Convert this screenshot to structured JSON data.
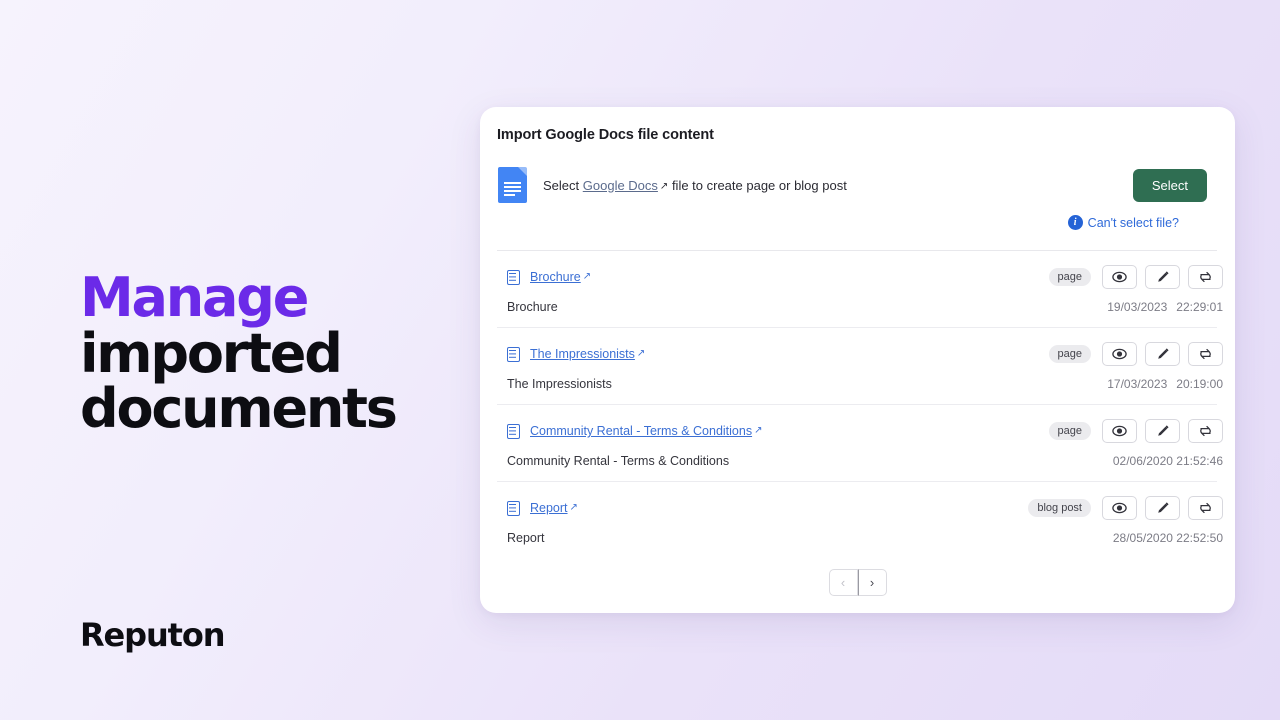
{
  "promo": {
    "headline_accent": "Manage",
    "headline_line2": "imported",
    "headline_line3": "documents",
    "accent_color": "#6b2ae8",
    "brand_name": "Reputon"
  },
  "card": {
    "title": "Import Google Docs file content",
    "picker": {
      "file_icon": "google-docs-file-icon",
      "text_before": "Select",
      "link_label": "Google Docs",
      "external_glyph": "↗",
      "text_after": "file to create page or blog post",
      "select_button": "Select",
      "select_button_color": "#2f6e52"
    },
    "help": {
      "info_icon": "info-circle-icon",
      "link_label": "Can't select file?",
      "link_color": "#2f6ad9"
    },
    "rows": [
      {
        "icon": "document-icon",
        "link_label": "Brochure",
        "badge": "page",
        "description": "Brochure",
        "date": "19/03/2023",
        "time": "22:29:01",
        "actions": [
          "preview-eye-icon",
          "edit-pencil-icon",
          "sync-refresh-icon"
        ]
      },
      {
        "icon": "document-icon",
        "link_label": "The Impressionists",
        "badge": "page",
        "description": "The Impressionists",
        "date": "17/03/2023",
        "time": "20:19:00",
        "actions": [
          "preview-eye-icon",
          "edit-pencil-icon",
          "sync-refresh-icon"
        ]
      },
      {
        "icon": "document-icon",
        "link_label": "Community Rental - Terms & Conditions",
        "badge": "page",
        "description": "Community Rental - Terms & Conditions",
        "date": "02/06/2020",
        "time": "21:52:46",
        "actions": [
          "preview-eye-icon",
          "edit-pencil-icon",
          "sync-refresh-icon"
        ]
      },
      {
        "icon": "document-icon",
        "link_label": "Report",
        "badge": "blog post",
        "description": "Report",
        "date": "28/05/2020",
        "time": "22:52:50",
        "actions": [
          "preview-eye-icon",
          "edit-pencil-icon",
          "sync-refresh-icon"
        ]
      }
    ],
    "pagination": {
      "prev_label": "‹",
      "next_label": "›"
    }
  }
}
